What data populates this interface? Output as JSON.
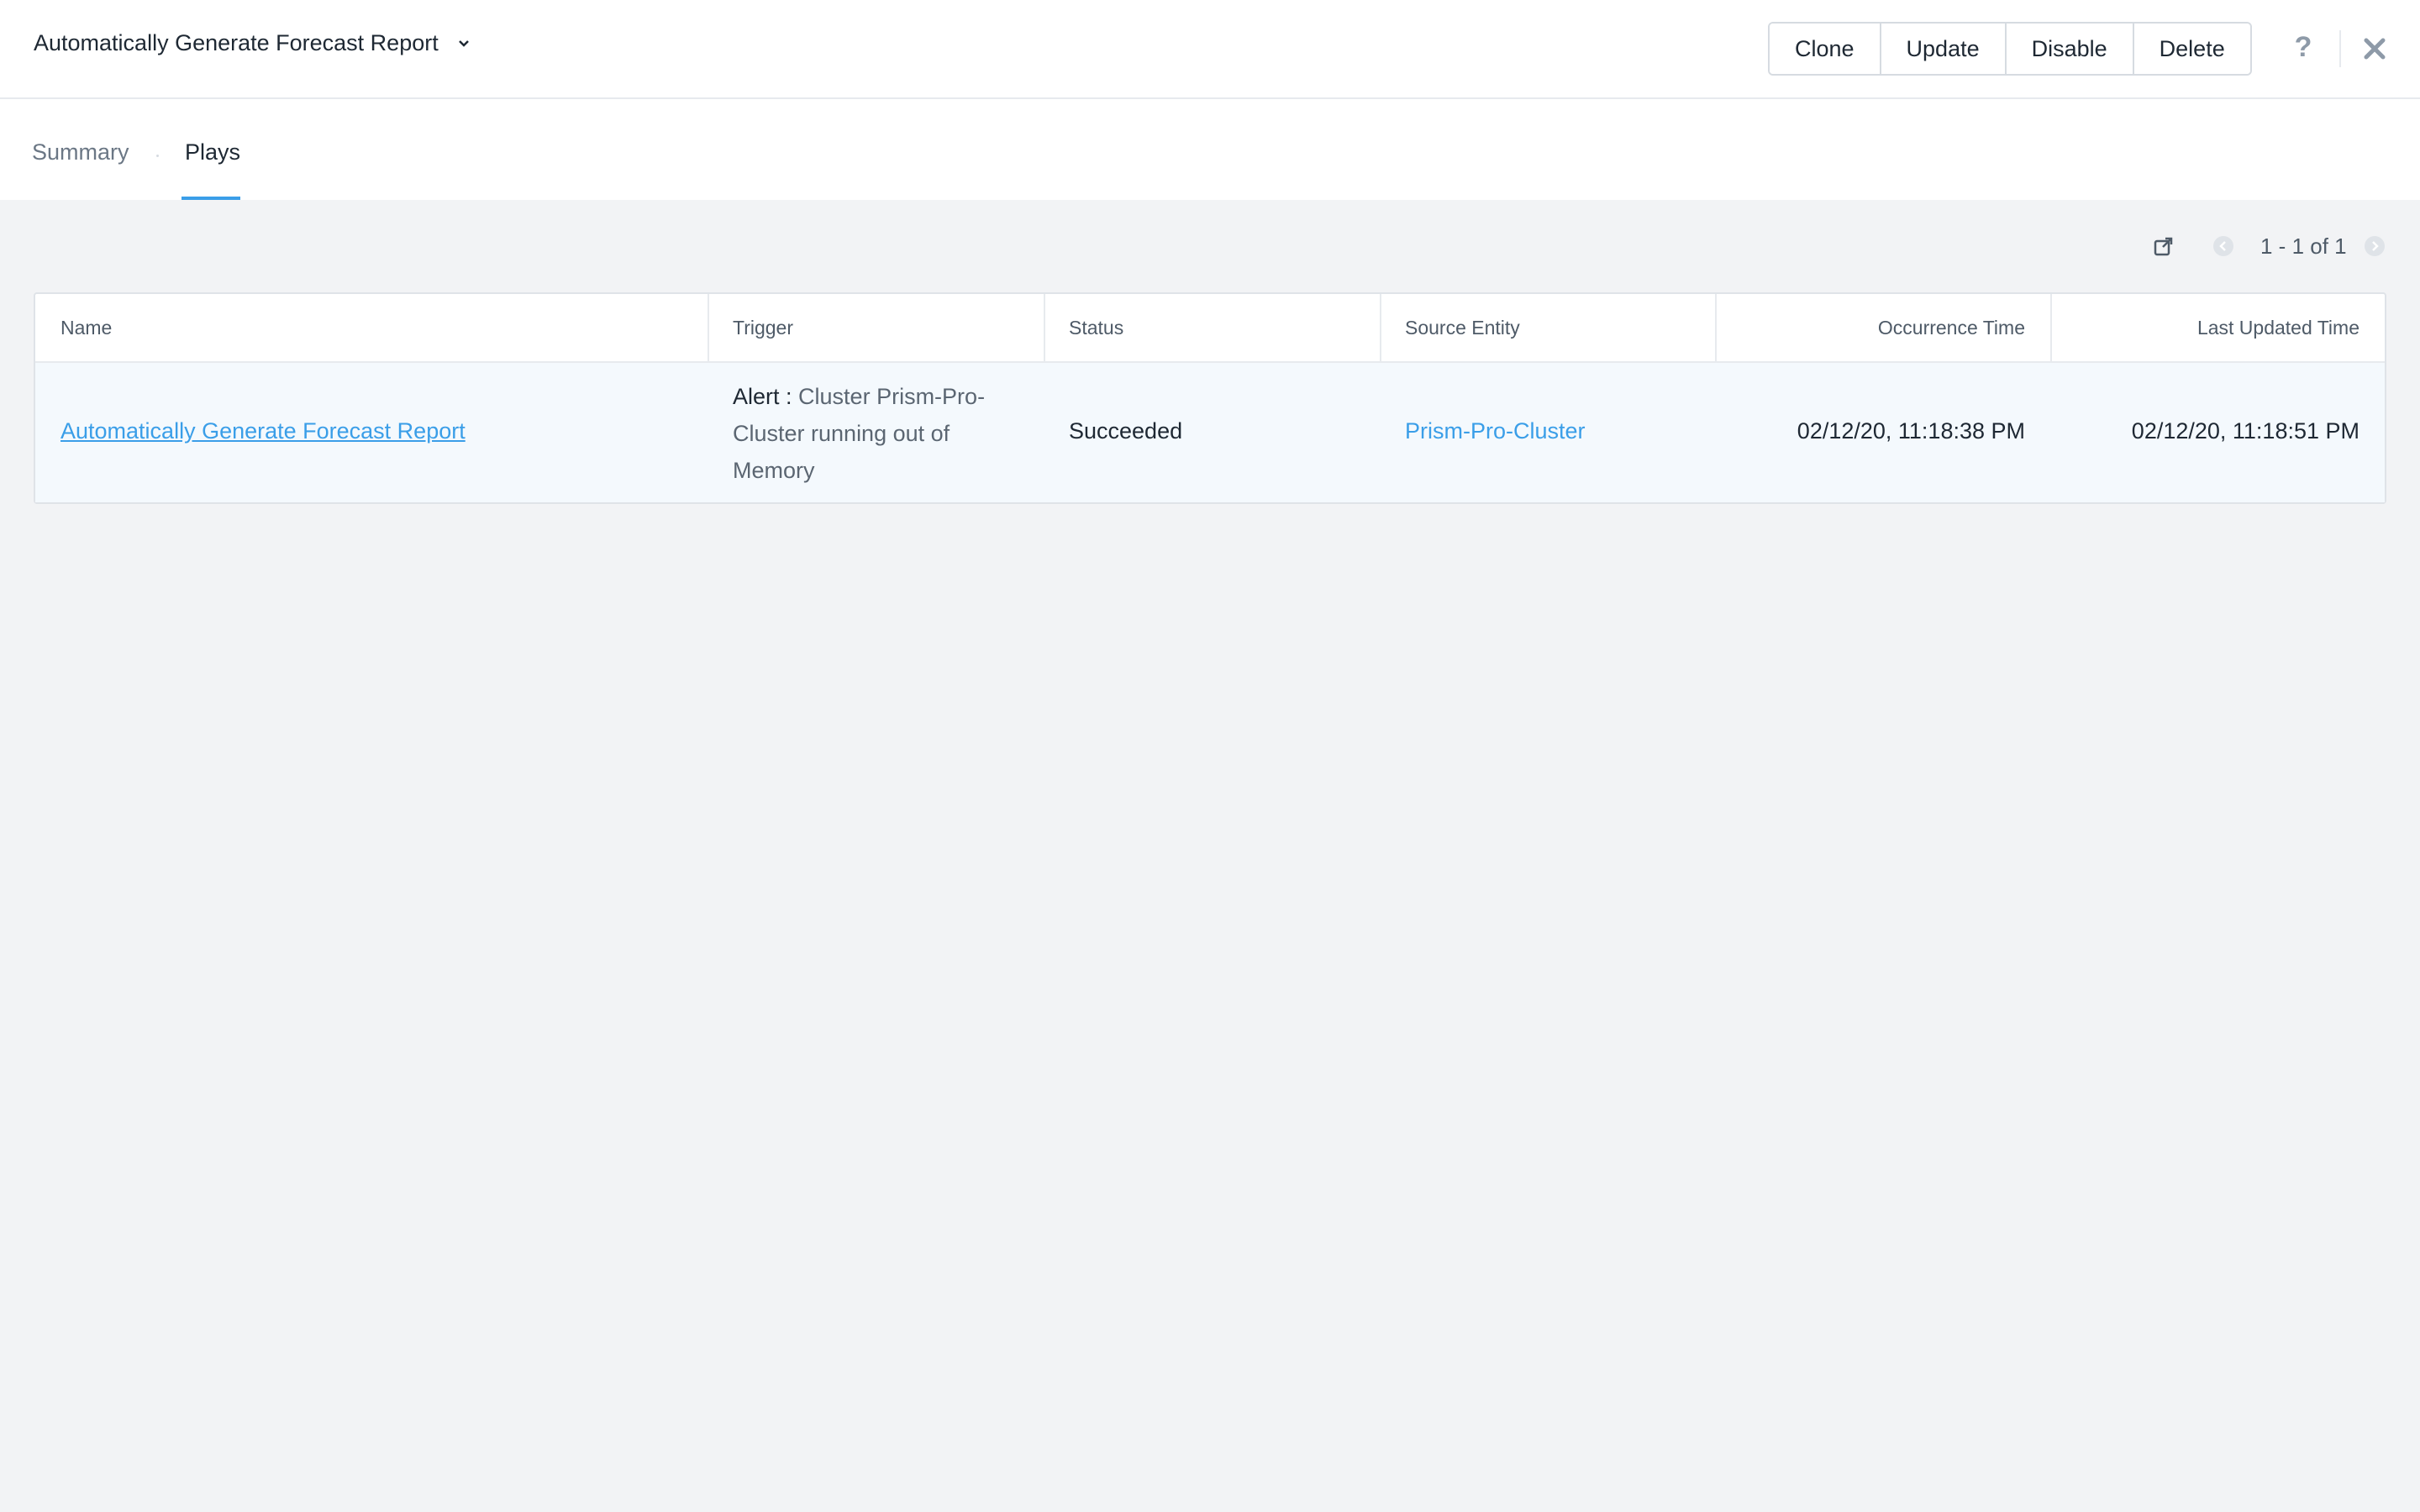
{
  "header": {
    "title": "Automatically Generate Forecast Report",
    "buttons": {
      "clone": "Clone",
      "update": "Update",
      "disable": "Disable",
      "delete": "Delete"
    },
    "help_icon": "?",
    "icons": [
      "chevron-down-icon",
      "help-icon",
      "close-icon"
    ]
  },
  "tabs": [
    {
      "label": "Summary",
      "active": false
    },
    {
      "label": "Plays",
      "active": true
    }
  ],
  "pager": {
    "text": "1 - 1 of 1"
  },
  "table": {
    "columns": [
      "Name",
      "Trigger",
      "Status",
      "Source Entity",
      "Occurrence Time",
      "Last Updated Time"
    ],
    "rows": [
      {
        "name": "Automatically Generate Forecast Report",
        "trigger_type": "Alert :",
        "trigger_text": "Cluster Prism-Pro-Cluster running out of Memory",
        "status": "Succeeded",
        "source_entity": "Prism-Pro-Cluster",
        "occurrence_time": "02/12/20, 11:18:38 PM",
        "last_updated_time": "02/12/20, 11:18:51 PM"
      }
    ]
  },
  "colors": {
    "accent": "#3a9ee8",
    "background": "#f2f3f5",
    "row_highlight": "#f4f9fd"
  }
}
